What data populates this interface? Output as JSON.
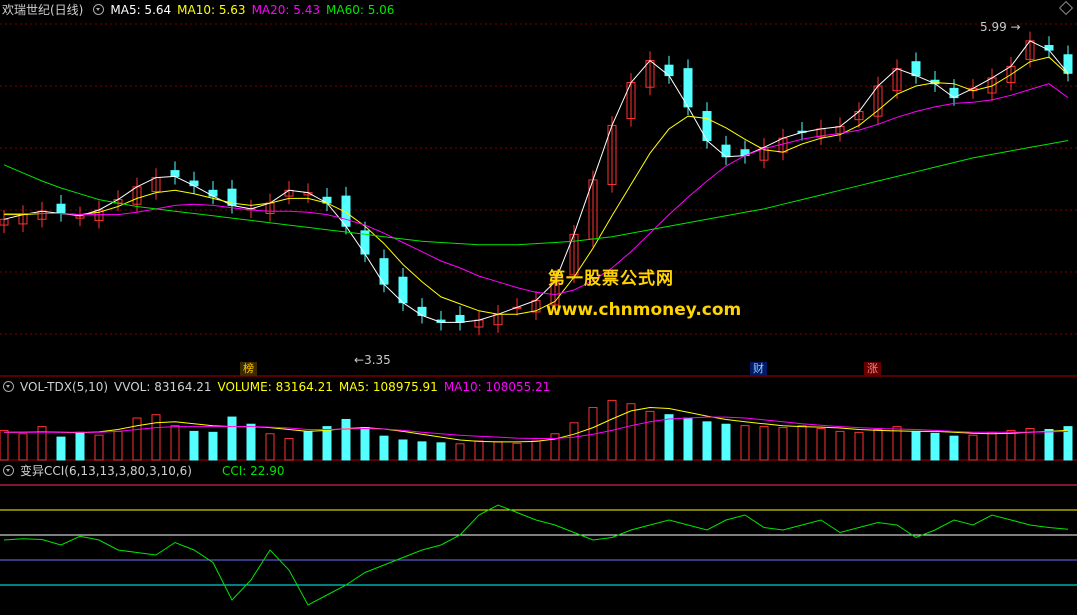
{
  "header": {
    "stock_name": "欢瑞世纪(日线)",
    "ma5": "MA5: 5.64",
    "ma10": "MA10: 5.63",
    "ma20": "MA20: 5.43",
    "ma60": "MA60: 5.06"
  },
  "vol_header": {
    "name": "VOL-TDX(5,10)",
    "vvol": "VVOL: 83164.21",
    "volume": "VOLUME: 83164.21",
    "ma5": "MA5: 108975.91",
    "ma10": "MA10: 108055.21"
  },
  "cci_header": {
    "name": "变异CCI(6,13,13,3,80,3,10,6)",
    "cci": "CCI: 22.90"
  },
  "annotations": {
    "high_label": "5.99",
    "low_label": "3.35",
    "badge_bang": "榜",
    "badge_cai": "财",
    "badge_zhang": "涨"
  },
  "watermark": {
    "line1": "第一股票公式网",
    "line2": "www.chnmoney.com"
  },
  "colors": {
    "up": "#ff3232",
    "down": "#54ffff",
    "ma5": "#ffffff",
    "ma10": "#ffff00",
    "ma20": "#ff00ff",
    "ma60": "#00e600",
    "cci": "#00e600",
    "grid": "#7a0000"
  },
  "chart_data": [
    {
      "type": "line",
      "title": "欢瑞世纪(日线)",
      "series": [
        {
          "name": "MA5",
          "values": [
            4.38,
            4.42,
            4.45,
            4.43,
            4.41,
            4.46,
            4.55,
            4.66,
            4.74,
            4.75,
            4.67,
            4.58,
            4.5,
            4.47,
            4.52,
            4.63,
            4.61,
            4.52,
            4.32,
            4.08,
            3.82,
            3.66,
            3.55,
            3.49,
            3.49,
            3.51,
            3.56,
            3.62,
            3.68,
            3.84,
            4.25,
            4.72,
            5.19,
            5.56,
            5.75,
            5.62,
            5.35,
            5.06,
            4.92,
            4.93,
            5.0,
            5.08,
            5.13,
            5.16,
            5.18,
            5.31,
            5.53,
            5.68,
            5.62,
            5.55,
            5.43,
            5.51,
            5.6,
            5.7,
            5.92,
            5.84,
            5.64
          ]
        },
        {
          "name": "MA10",
          "values": [
            4.42,
            4.42,
            4.43,
            4.43,
            4.42,
            4.44,
            4.49,
            4.56,
            4.61,
            4.63,
            4.6,
            4.56,
            4.52,
            4.5,
            4.52,
            4.56,
            4.56,
            4.52,
            4.44,
            4.32,
            4.17,
            3.99,
            3.84,
            3.71,
            3.65,
            3.59,
            3.56,
            3.56,
            3.59,
            3.67,
            3.88,
            4.13,
            4.41,
            4.68,
            4.95,
            5.16,
            5.27,
            5.25,
            5.17,
            5.07,
            4.98,
            4.96,
            5.03,
            5.08,
            5.11,
            5.19,
            5.32,
            5.46,
            5.53,
            5.56,
            5.55,
            5.49,
            5.53,
            5.63,
            5.74,
            5.78,
            5.63
          ]
        },
        {
          "name": "MA20",
          "values": [
            4.43,
            4.43,
            4.43,
            4.43,
            4.42,
            4.42,
            4.42,
            4.44,
            4.47,
            4.5,
            4.51,
            4.5,
            4.48,
            4.46,
            4.45,
            4.45,
            4.44,
            4.42,
            4.38,
            4.33,
            4.26,
            4.18,
            4.1,
            4.02,
            3.96,
            3.89,
            3.84,
            3.79,
            3.75,
            3.73,
            3.77,
            3.85,
            3.96,
            4.1,
            4.26,
            4.42,
            4.57,
            4.71,
            4.84,
            4.93,
            4.99,
            5.03,
            5.07,
            5.1,
            5.12,
            5.15,
            5.2,
            5.26,
            5.31,
            5.35,
            5.38,
            5.39,
            5.41,
            5.45,
            5.5,
            5.55,
            5.43
          ]
        },
        {
          "name": "MA60",
          "values": [
            4.85,
            4.78,
            4.71,
            4.65,
            4.6,
            4.55,
            4.52,
            4.49,
            4.47,
            4.45,
            4.43,
            4.41,
            4.39,
            4.37,
            4.35,
            4.33,
            4.31,
            4.29,
            4.27,
            4.25,
            4.23,
            4.21,
            4.19,
            4.18,
            4.17,
            4.16,
            4.16,
            4.16,
            4.17,
            4.18,
            4.19,
            4.21,
            4.23,
            4.26,
            4.29,
            4.32,
            4.35,
            4.38,
            4.41,
            4.44,
            4.47,
            4.51,
            4.55,
            4.59,
            4.63,
            4.67,
            4.71,
            4.75,
            4.79,
            4.83,
            4.87,
            4.91,
            4.94,
            4.97,
            5.0,
            5.03,
            5.06
          ]
        }
      ],
      "annotations": [
        {
          "text": "5.99",
          "type": "high"
        },
        {
          "text": "3.35",
          "type": "low"
        }
      ]
    },
    {
      "type": "bar",
      "title": "VOL-TDX(5,10)",
      "values": [
        62,
        55,
        70,
        48,
        58,
        52,
        60,
        88,
        95,
        72,
        60,
        58,
        90,
        75,
        55,
        45,
        60,
        70,
        85,
        68,
        50,
        42,
        38,
        36,
        34,
        40,
        38,
        35,
        40,
        55,
        78,
        110,
        125,
        118,
        102,
        95,
        88,
        80,
        75,
        72,
        70,
        68,
        72,
        66,
        60,
        58,
        64,
        70,
        60,
        56,
        50,
        52,
        58,
        62,
        66,
        64,
        70
      ],
      "series": [
        {
          "name": "MA5",
          "values": [
            58,
            58,
            59,
            58,
            57,
            59,
            64,
            72,
            78,
            80,
            76,
            72,
            70,
            70,
            68,
            64,
            60,
            62,
            66,
            68,
            65,
            60,
            54,
            48,
            42,
            39,
            38,
            38,
            39,
            44,
            54,
            68,
            86,
            103,
            110,
            108,
            100,
            92,
            85,
            80,
            76,
            72,
            70,
            69,
            67,
            64,
            62,
            61,
            60,
            60,
            58,
            56,
            55,
            56,
            58,
            60,
            62
          ]
        },
        {
          "name": "MA10",
          "values": [
            58,
            58,
            58,
            58,
            58,
            58,
            60,
            64,
            68,
            70,
            70,
            70,
            70,
            70,
            69,
            67,
            64,
            64,
            65,
            66,
            65,
            62,
            58,
            55,
            52,
            50,
            48,
            46,
            45,
            45,
            48,
            54,
            62,
            72,
            80,
            86,
            88,
            90,
            90,
            88,
            84,
            80,
            76,
            73,
            70,
            68,
            66,
            65,
            64,
            62,
            60,
            58,
            58,
            58,
            58,
            59,
            60
          ]
        }
      ]
    },
    {
      "type": "line",
      "title": "变异CCI(6,13,13,3,80,3,10,6)",
      "series": [
        {
          "name": "CCI",
          "values": [
            -20,
            -15,
            -18,
            -40,
            -5,
            -20,
            -60,
            -70,
            -80,
            -30,
            -60,
            -110,
            -260,
            -180,
            -60,
            -140,
            -280,
            -240,
            -200,
            -150,
            -120,
            -90,
            -60,
            -40,
            0,
            80,
            120,
            90,
            60,
            40,
            10,
            -20,
            -10,
            20,
            40,
            60,
            40,
            20,
            60,
            80,
            30,
            20,
            40,
            60,
            10,
            30,
            50,
            40,
            -10,
            20,
            60,
            40,
            80,
            60,
            40,
            30,
            22.9
          ]
        }
      ]
    }
  ]
}
